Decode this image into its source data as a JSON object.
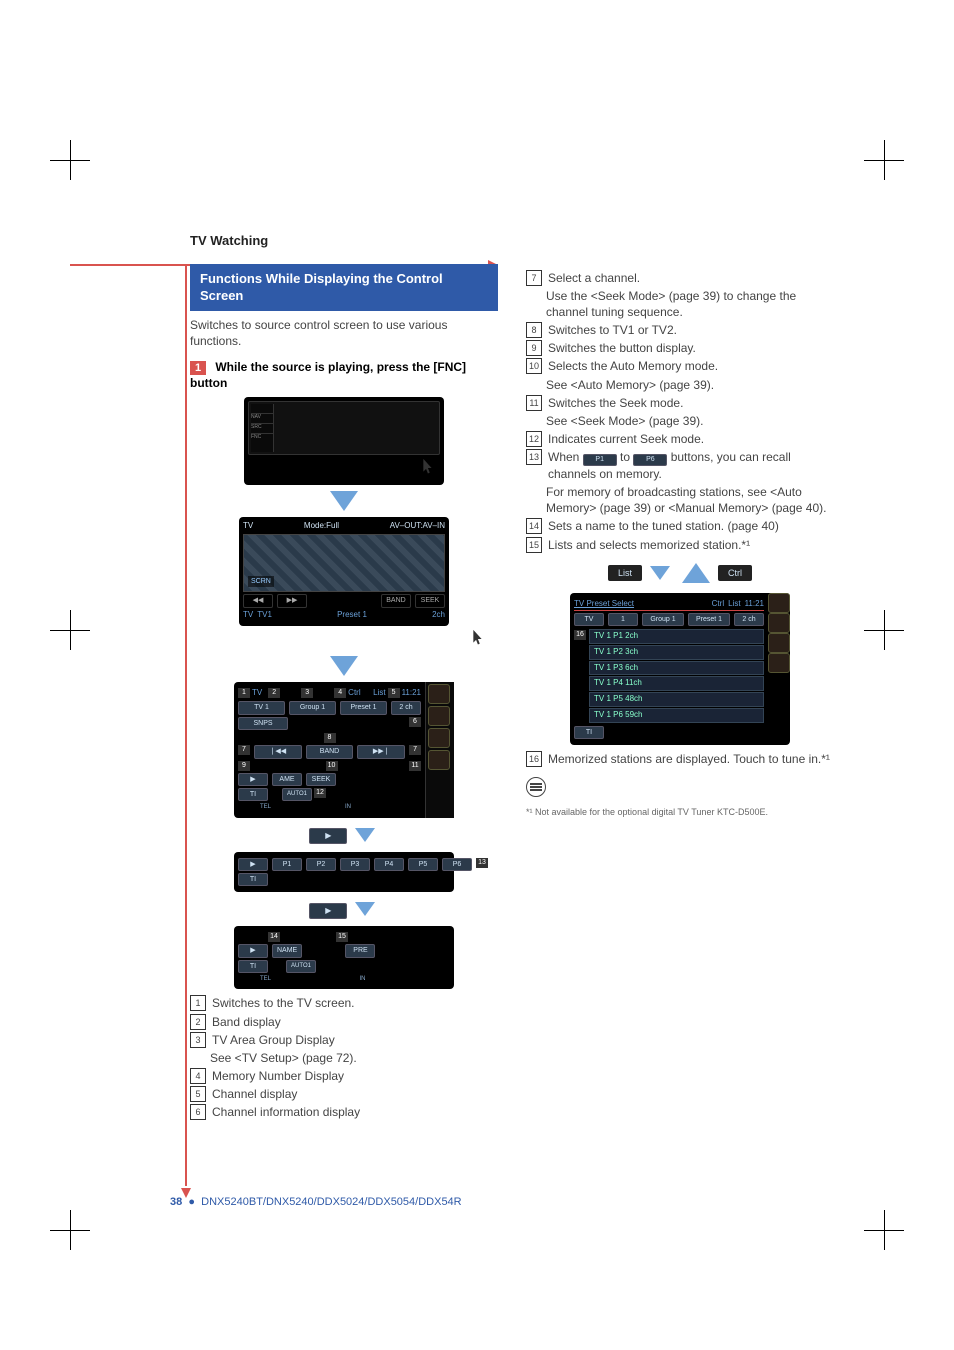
{
  "header": "TV Watching",
  "box_title": "Functions While Displaying the Control Screen",
  "intro": "Switches to source control screen to use various functions.",
  "step1": {
    "num": "1",
    "text": "While the source is playing, press the [FNC] button"
  },
  "scr_tv": {
    "title": "TV",
    "mode": "Mode:Full",
    "avout": "AV–OUT:AV–IN",
    "scrn": "SCRN",
    "band": "BAND",
    "seek": "SEEK",
    "tvlabel": "TV",
    "tv1": "TV1",
    "preset": "Preset 1",
    "ch": "2ch"
  },
  "scr_ctrl": {
    "tv": "TV",
    "tv1": "TV 1",
    "group": "Group 1",
    "ctrl": "Ctrl",
    "list": "List",
    "time": "11:21",
    "preset": "Preset 1",
    "ch": "2 ch",
    "snps": "SNPS",
    "band": "BAND",
    "ame": "AME",
    "seek": "SEEK",
    "auto": "AUTO1",
    "ti": "TI",
    "tel": "TEL",
    "in": "IN",
    "play": "▶",
    "prev": "❘◀◀",
    "next": "▶▶❘"
  },
  "scr_presets": {
    "p": [
      "P1",
      "P2",
      "P3",
      "P4",
      "P5",
      "P6"
    ],
    "ti": "TI",
    "play": "▶"
  },
  "scr_name": {
    "name": "NAME",
    "pre": "PRE",
    "auto": "AUTO1",
    "ti": "TI",
    "tel": "TEL",
    "in": "IN",
    "play": "▶"
  },
  "legend_left": [
    {
      "n": "1",
      "t": "Switches to the TV screen."
    },
    {
      "n": "2",
      "t": "Band display"
    },
    {
      "n": "3",
      "t": "TV Area Group Display",
      "sub": "See <TV Setup> (page 72)."
    },
    {
      "n": "4",
      "t": "Memory Number Display"
    },
    {
      "n": "5",
      "t": "Channel display"
    },
    {
      "n": "6",
      "t": "Channel information display"
    }
  ],
  "legend_right": [
    {
      "n": "7",
      "t": "Select a channel.",
      "sub": "Use the <Seek Mode> (page 39) to change the channel tuning sequence."
    },
    {
      "n": "8",
      "t": "Switches to TV1 or TV2."
    },
    {
      "n": "9",
      "t": "Switches the button display."
    },
    {
      "n": "10",
      "t": "Selects the Auto Memory mode.",
      "sub": "See <Auto Memory> (page 39)."
    },
    {
      "n": "11",
      "t": "Switches the Seek mode.",
      "sub": "See <Seek Mode> (page 39)."
    },
    {
      "n": "12",
      "t": "Indicates current Seek mode."
    },
    {
      "n": "13",
      "pre": "When ",
      "mid": " to ",
      "post": " buttons, you can recall channels on memory.",
      "sub": "For memory of broadcasting stations, see <Auto Memory> (page 39) or <Manual Memory> (page 40).",
      "b1": "P1",
      "b2": "P6"
    },
    {
      "n": "14",
      "t": "Sets a name to the tuned station. (page 40)"
    },
    {
      "n": "15",
      "t": "Lists and selects memorized station.*¹"
    }
  ],
  "tabs": {
    "list": "List",
    "ctrl": "Ctrl"
  },
  "preset_screen": {
    "hdr": "TV Preset Select",
    "ctrl": "Ctrl",
    "list": "List",
    "time": "11:21",
    "tv": "TV",
    "one": "1",
    "group": "Group 1",
    "preset": "Preset 1",
    "ch": "2 ch",
    "rows": [
      "TV 1 P1  2ch",
      "TV 1 P2  3ch",
      "TV 1 P3  6ch",
      "TV 1 P4  11ch",
      "TV 1 P5  48ch",
      "TV 1 P6  59ch"
    ],
    "ti": "TI"
  },
  "legend16": {
    "n": "16",
    "t": "Memorized stations are displayed. Touch to tune in.*¹"
  },
  "footnote": "*¹ Not available for the optional digital TV Tuner KTC-D500E.",
  "footer": {
    "page": "38",
    "models": "DNX5240BT/DNX5240/DDX5024/DDX5054/DDX54R"
  },
  "callouts": {
    "c1": "1",
    "c2": "2",
    "c3": "3",
    "c4": "4",
    "c5": "5",
    "c6": "6",
    "c7": "7",
    "c8": "8",
    "c9": "9",
    "c10": "10",
    "c11": "11",
    "c12": "12",
    "c13": "13",
    "c14": "14",
    "c15": "15",
    "c16": "16"
  },
  "misc": {
    "preset_btn_p1": "P1",
    "preset_btn_p6": "P6"
  }
}
